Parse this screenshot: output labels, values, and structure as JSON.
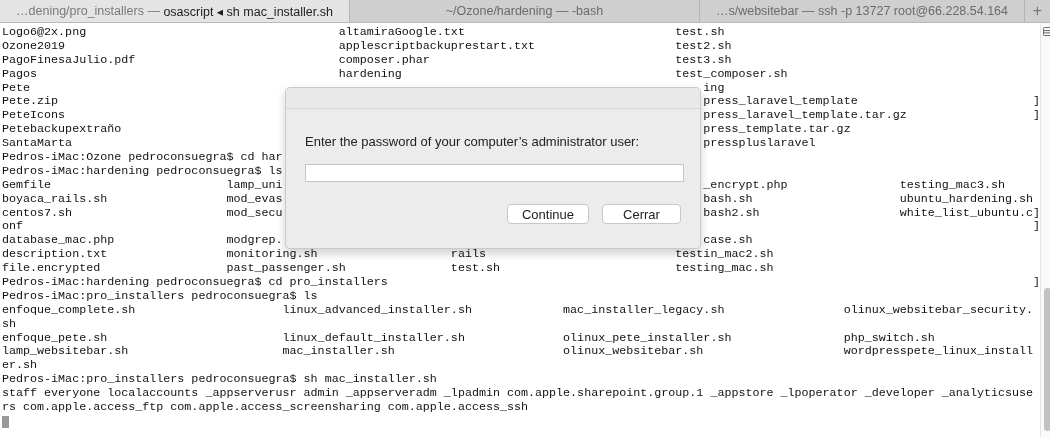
{
  "tabs": [
    {
      "path": "…dening/pro_installers —",
      "command": "osascript ◂ sh mac_installer.sh",
      "selected": true
    },
    {
      "path": "~/Ozone/hardening —",
      "command": "-bash",
      "selected": false
    },
    {
      "path": "…s/websitebar —",
      "command": "ssh -p 13727 root@66.228.54.164",
      "selected": false
    }
  ],
  "new_tab_button": "+",
  "lines": [
    {
      "kind": "full",
      "text": "Logo6@2x.png                                    altamiraGoogle.txt                              test.sh"
    },
    {
      "kind": "full",
      "text": "Ozone2019                                       applescriptbackuprestart.txt                    test2.sh"
    },
    {
      "kind": "full",
      "text": "PagoFinesaJulio.pdf                             composer.phar                                   test3.sh"
    },
    {
      "kind": "full",
      "text": "Pagos                                           hardening                                       test_composer.sh"
    },
    {
      "kind": "split",
      "left": "Pete",
      "right": "ing"
    },
    {
      "kind": "split",
      "left": "Pete.zip",
      "right": "press_laravel_template                         ]"
    },
    {
      "kind": "split",
      "left": "PeteIcons",
      "right": "press_laravel_template.tar.gz                  ]"
    },
    {
      "kind": "split",
      "left": "Petebackupextraño",
      "right": "press_template.tar.gz"
    },
    {
      "kind": "split",
      "left": "SantaMarta",
      "right": "presspluslaravel"
    },
    {
      "kind": "split",
      "left": "Pedros-iMac:Ozone pedroconsuegra$ cd har"
    },
    {
      "kind": "split",
      "left": "Pedros-iMac:hardening pedroconsuegra$ ls"
    },
    {
      "kind": "split",
      "left": "Gemfile                         lamp_uni",
      "right": "_encrypt.php                testing_mac3.sh"
    },
    {
      "kind": "split",
      "left": "boyaca_rails.sh                 mod_evas",
      "right": "bash.sh                     ubuntu_hardening.sh"
    },
    {
      "kind": "split",
      "left": "centos7.sh                      mod_secu",
      "right": "bash2.sh                    white_list_ubuntu.c]"
    },
    {
      "kind": "split",
      "left": "onf",
      "right": "                                               ]"
    },
    {
      "kind": "split",
      "left": "database_mac.php                modgrep.",
      "right": "case.sh"
    },
    {
      "kind": "full",
      "text": "description.txt                 monitoring.sh                   rails                           testin_mac2.sh"
    },
    {
      "kind": "full",
      "text": "file.encrypted                  past_passenger.sh               test.sh                         testing_mac.sh"
    },
    {
      "kind": "full",
      "text": "Pedros-iMac:hardening pedroconsuegra$ cd pro_installers                                                                                            ]"
    },
    {
      "kind": "full",
      "text": "Pedros-iMac:pro_installers pedroconsuegra$ ls"
    },
    {
      "kind": "full",
      "text": "enfoque_complete.sh                     linux_advanced_installer.sh             mac_installer_legacy.sh                 olinux_websitebar_security."
    },
    {
      "kind": "full",
      "text": "sh"
    },
    {
      "kind": "full",
      "text": "enfoque_pete.sh                         linux_default_installer.sh              olinux_pete_installer.sh                php_switch.sh"
    },
    {
      "kind": "full",
      "text": "lamp_websitebar.sh                      mac_installer.sh                        olinux_websitebar.sh                    wordpresspete_linux_install"
    },
    {
      "kind": "full",
      "text": "er.sh"
    },
    {
      "kind": "full",
      "text": "Pedros-iMac:pro_installers pedroconsuegra$ sh mac_installer.sh"
    },
    {
      "kind": "full",
      "text": "staff everyone localaccounts _appserverusr admin _appserveradm _lpadmin com.apple.sharepoint.group.1 _appstore _lpoperator _developer _analyticsuse"
    },
    {
      "kind": "full",
      "text": "rs com.apple.access_ftp com.apple.access_screensharing com.apple.access_ssh"
    }
  ],
  "cursor": true,
  "dialog": {
    "message": "Enter the password of your computer’s administrator user:",
    "buttons": [
      {
        "label": "Continue"
      },
      {
        "label": "Cerrar"
      }
    ]
  }
}
